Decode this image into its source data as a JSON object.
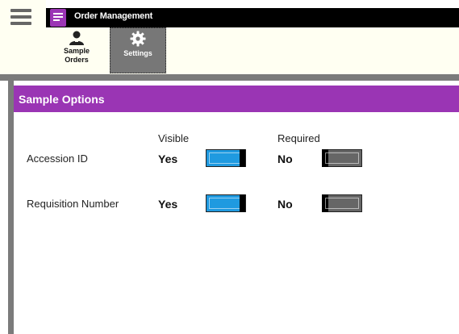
{
  "app": {
    "title": "Order Management"
  },
  "toolbar": {
    "sample_orders_label": "Sample Orders",
    "settings_label": "Settings"
  },
  "panel": {
    "title": "Sample Options",
    "columns": {
      "visible": "Visible",
      "required": "Required"
    },
    "rows": [
      {
        "label": "Accession ID",
        "visible_value": "Yes",
        "visible_on": true,
        "required_value": "No",
        "required_on": false
      },
      {
        "label": "Requisition Number",
        "visible_value": "Yes",
        "visible_on": true,
        "required_value": "No",
        "required_on": false
      }
    ]
  },
  "colors": {
    "accent": "#9a35b4",
    "toggle_on": "#1f9ae0",
    "toggle_off": "#666666"
  },
  "icons": {
    "menu": "hamburger-icon",
    "app": "app-list-icon",
    "orders": "user-icon",
    "settings": "gear-icon"
  }
}
